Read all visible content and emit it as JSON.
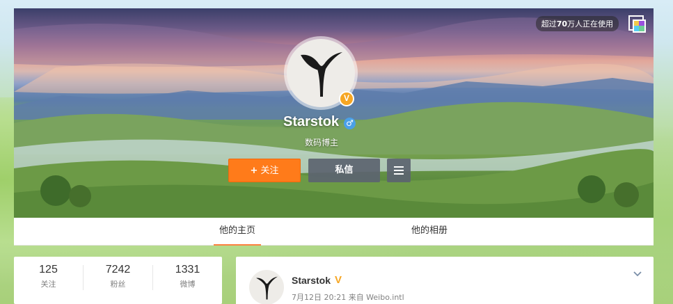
{
  "usage_badge": {
    "prefix": "超过",
    "count": "70",
    "suffix": "万人正在使用"
  },
  "profile": {
    "name": "Starstok",
    "description": "数码博主",
    "verified_badge": "V",
    "gender_symbol": "♂"
  },
  "actions": {
    "follow_plus": "+",
    "follow_label": "关注",
    "message_label": "私信"
  },
  "tabs": [
    {
      "label": "他的主页",
      "active": true
    },
    {
      "label": "他的相册",
      "active": false
    }
  ],
  "stats": [
    {
      "value": "125",
      "label": "关注"
    },
    {
      "value": "7242",
      "label": "粉丝"
    },
    {
      "value": "1331",
      "label": "微博"
    }
  ],
  "feed": {
    "author": "Starstok",
    "vip_badge": "V",
    "meta": "7月12日 20:21 来自 Weibo.intl"
  },
  "icons": {
    "skin": "skin-palette-icon",
    "more": "menu-icon",
    "expand": "chevron-down-icon",
    "avatar": "whale-tail-logo"
  },
  "colors": {
    "accent": "#ff7b1a",
    "verified": "#f6a623",
    "gender": "#4aa0e8",
    "tab_active": "#ff8140"
  }
}
